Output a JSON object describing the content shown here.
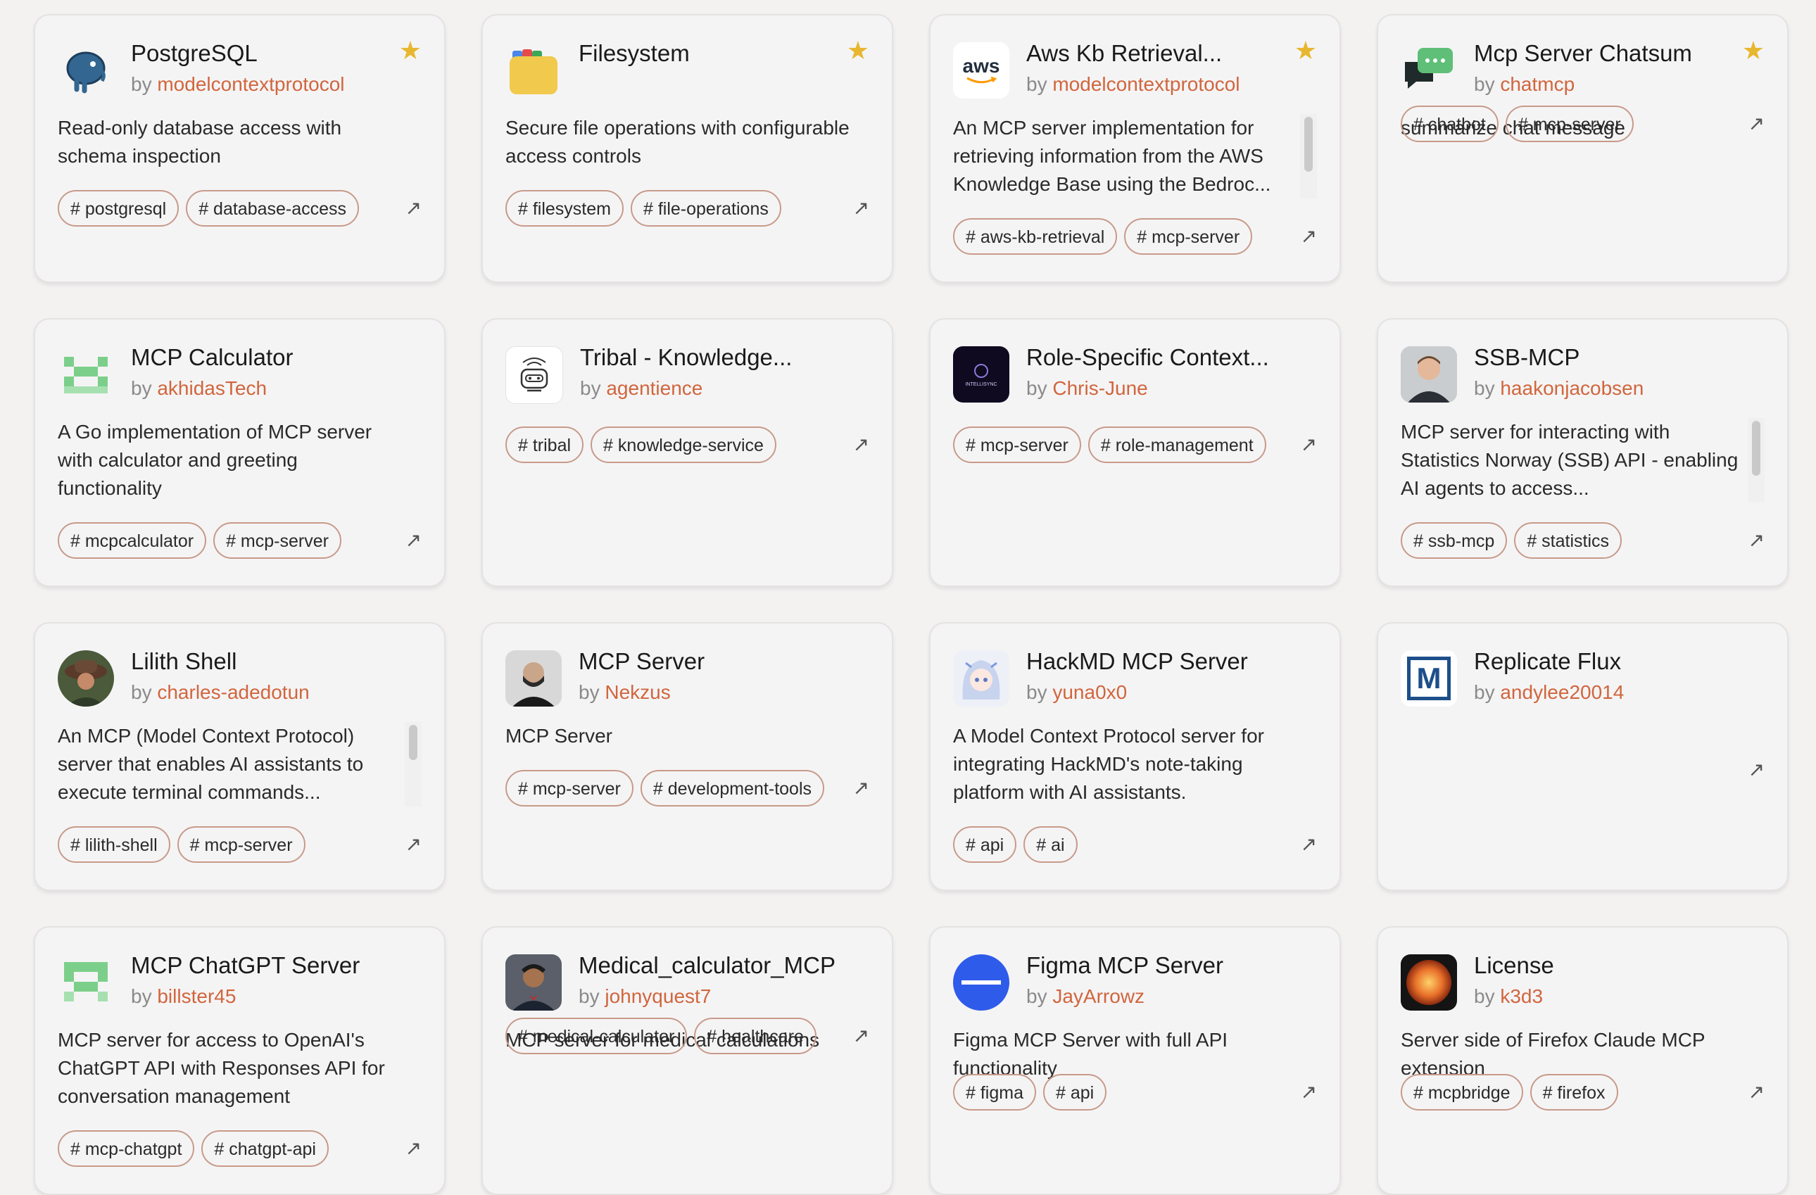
{
  "author_prefix": "by",
  "cards": [
    {
      "title": "PostgreSQL",
      "author": "modelcontextprotocol",
      "starred": true,
      "description": "Read-only database access with schema inspection",
      "tags": [
        "# postgresql",
        "# database-access"
      ],
      "logo": "postgresql-elephant-icon"
    },
    {
      "title": "Filesystem",
      "author": "",
      "starred": true,
      "description": "Secure file operations with configurable access controls",
      "tags": [
        "# filesystem",
        "# file-operations"
      ],
      "logo": "folder-icon"
    },
    {
      "title": "Aws Kb Retrieval...",
      "author": "modelcontextprotocol",
      "starred": true,
      "description": "An MCP server implementation for retrieving information from the AWS Knowledge Base using the Bedroc...",
      "tags": [
        "# aws-kb-retrieval",
        "# mcp-server"
      ],
      "logo": "aws-logo",
      "logo_text": "aws"
    },
    {
      "title": "Mcp Server Chatsum",
      "author": "chatmcp",
      "starred": true,
      "description": "summarize chat message",
      "tags": [
        "# chatbot",
        "# mcp-server"
      ],
      "logo": "chat-bubbles-icon"
    },
    {
      "title": "MCP Calculator",
      "author": "akhidasTech",
      "starred": false,
      "description": "A Go implementation of MCP server with calculator and greeting functionality",
      "tags": [
        "# mcpcalculator",
        "# mcp-server"
      ],
      "logo": "green-pixel-pattern-icon"
    },
    {
      "title": "Tribal - Knowledge...",
      "author": "agentience",
      "starred": false,
      "description": "",
      "tags": [
        "# tribal",
        "# knowledge-service"
      ],
      "logo": "robot-icon"
    },
    {
      "title": "Role-Specific Context...",
      "author": "Chris-June",
      "starred": false,
      "description": "",
      "tags": [
        "# mcp-server",
        "# role-management"
      ],
      "logo": "intellisync-logo",
      "logo_text": "INTELLISYNC"
    },
    {
      "title": "SSB-MCP",
      "author": "haakonjacobsen",
      "starred": false,
      "description": "MCP server for interacting with Statistics Norway (SSB) API - enabling AI agents to access...",
      "tags": [
        "# ssb-mcp",
        "# statistics"
      ],
      "logo": "avatar-photo"
    },
    {
      "title": "Lilith Shell",
      "author": "charles-adedotun",
      "starred": false,
      "description": "An MCP (Model Context Protocol) server that enables AI assistants to execute terminal commands...",
      "tags": [
        "# lilith-shell",
        "# mcp-server"
      ],
      "logo": "avatar-photo"
    },
    {
      "title": "MCP Server",
      "author": "Nekzus",
      "starred": false,
      "description": "MCP Server",
      "tags": [
        "# mcp-server",
        "# development-tools"
      ],
      "logo": "avatar-photo"
    },
    {
      "title": "HackMD MCP Server",
      "author": "yuna0x0",
      "starred": false,
      "description": "A Model Context Protocol server for integrating HackMD's note-taking platform with AI assistants.",
      "tags": [
        "# api",
        "# ai"
      ],
      "logo": "anime-avatar"
    },
    {
      "title": "Replicate Flux",
      "author": "andylee20014",
      "starred": false,
      "description": "",
      "tags": [],
      "logo": "m-logo",
      "logo_text": "M"
    },
    {
      "title": "MCP ChatGPT Server",
      "author": "billster45",
      "starred": false,
      "description": "MCP server for access to OpenAI's ChatGPT API with Responses API for conversation management",
      "tags": [
        "# mcp-chatgpt",
        "# chatgpt-api"
      ],
      "logo": "green-pixel-pattern-icon"
    },
    {
      "title": "Medical_calculator_MCP",
      "author": "johnyquest7",
      "starred": false,
      "description": "MCP server for medical calculations",
      "tags": [
        "# medical-calculator",
        "# healthcare"
      ],
      "logo": "avatar-photo"
    },
    {
      "title": "Figma MCP Server",
      "author": "JayArrowz",
      "starred": false,
      "description": "Figma MCP Server with full API functionality",
      "tags": [
        "# figma",
        "# api"
      ],
      "logo": "blue-circle-icon"
    },
    {
      "title": "License",
      "author": "k3d3",
      "starred": false,
      "description": "Server side of Firefox Claude MCP extension",
      "tags": [
        "# mcpbridge",
        "# firefox"
      ],
      "logo": "orange-sphere-icon"
    }
  ],
  "icons": {
    "star": "★",
    "arrow": "↗"
  },
  "colors": {
    "accent": "#d0663d",
    "star": "#e8b730",
    "tag_border": "#c79a8a"
  }
}
